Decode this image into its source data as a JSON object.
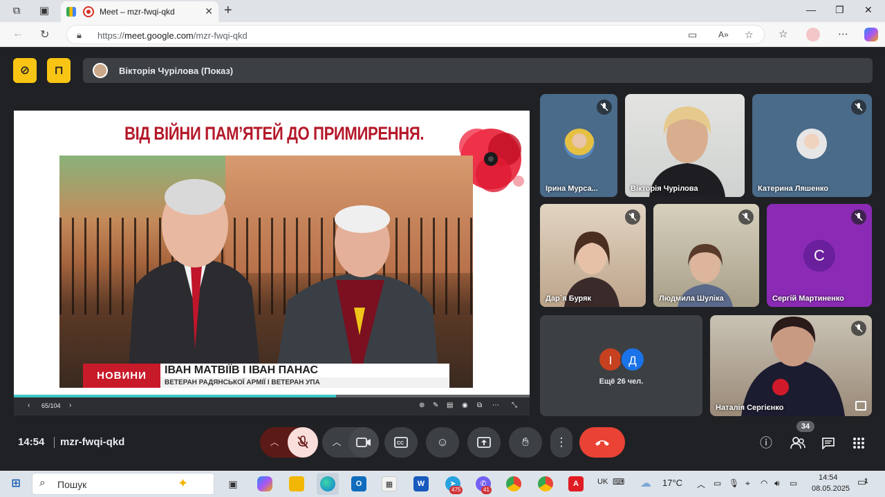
{
  "browser": {
    "tab_title": "Meet – mzr-fwqi-qkd",
    "tab_close": "✕",
    "new_tab": "+",
    "url_prefix": "https://",
    "url_host": "meet.google.com",
    "url_path": "/mzr-fwqi-qkd"
  },
  "meet": {
    "presenter_label": "Вікторія Чурілова (Показ)",
    "slide": {
      "title": "ВІД ВІЙНИ ПАМ’ЯТЕЙ ДО ПРИМИРЕННЯ.",
      "news_tag": "НОВИНИ",
      "names": "ІВАН МАТВІЇВ І ІВАН ПАНАС",
      "caption": "ВЕТЕРАН РАДЯНСЬКОЇ АРМІЇ І ВЕТЕРАН УПА",
      "page": "65/104",
      "progress": 0.625
    },
    "participants": [
      {
        "name": "Ірина Мурса...",
        "muted": true
      },
      {
        "name": "Вікторія Чурілова",
        "muted": false
      },
      {
        "name": "Катерина Ляшенко",
        "muted": true
      },
      {
        "name": "Дар`я Буряк",
        "muted": true
      },
      {
        "name": "Людмила Шуліка",
        "muted": true
      },
      {
        "name": "Сергій Мартиненко",
        "muted": true,
        "initial": "С"
      },
      {
        "name": "Наталія Сергієнко",
        "muted": true
      }
    ],
    "others": {
      "initials": [
        "І",
        "Д"
      ],
      "label": "Ещё 26 чел."
    },
    "clock": "14:54",
    "meeting_code": "mzr-fwqi-qkd",
    "people_count": "34"
  },
  "taskbar": {
    "search_placeholder": "Пошук",
    "lang": "UK",
    "weather": "17°C",
    "time": "14:54",
    "date": "08.05.2025",
    "telegram_badge": "475",
    "viber_badge": "41",
    "notifications": "1"
  },
  "colors": {
    "meet_bg": "#202124",
    "end_call": "#ea4335",
    "mic_off": "#f9dedc",
    "yellow_btn": "#f9c514",
    "slide_title": "#b4192a"
  }
}
